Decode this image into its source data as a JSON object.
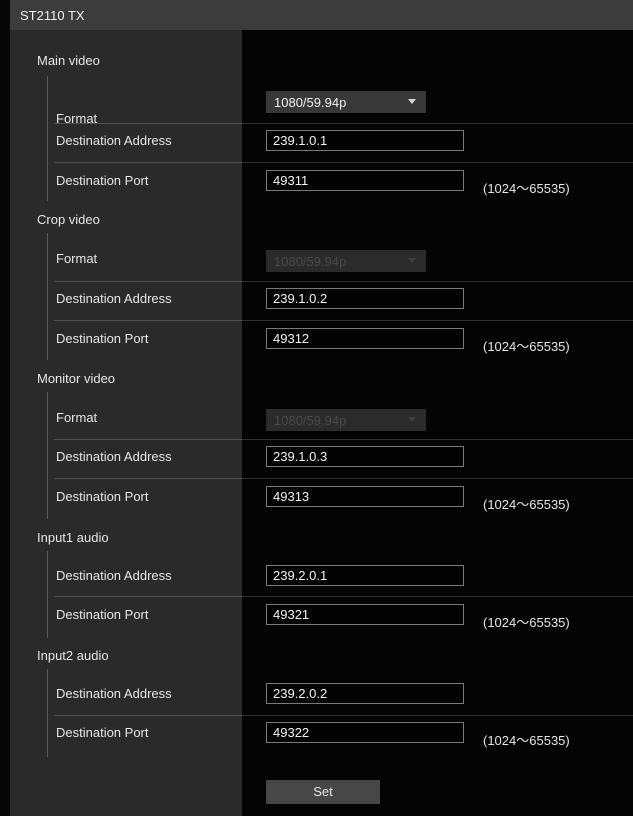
{
  "header": {
    "title": "ST2110 TX"
  },
  "main_video": {
    "title": "Main video",
    "format_label": "Format",
    "format_value": "1080/59.94p",
    "address_label": "Destination Address",
    "address_value": "239.1.0.1",
    "port_label": "Destination Port",
    "port_value": "49311",
    "port_range": "(1024～65535)"
  },
  "crop_video": {
    "title": "Crop video",
    "format_label": "Format",
    "format_value": "1080/59.94p",
    "address_label": "Destination Address",
    "address_value": "239.1.0.2",
    "port_label": "Destination Port",
    "port_value": "49312",
    "port_range": "(1024～65535)"
  },
  "monitor_video": {
    "title": "Monitor video",
    "format_label": "Format",
    "format_value": "1080/59.94p",
    "address_label": "Destination Address",
    "address_value": "239.1.0.3",
    "port_label": "Destination Port",
    "port_value": "49313",
    "port_range": "(1024～65535)"
  },
  "input1_audio": {
    "title": "Input1 audio",
    "address_label": "Destination Address",
    "address_value": "239.2.0.1",
    "port_label": "Destination Port",
    "port_value": "49321",
    "port_range": "(1024～65535)"
  },
  "input2_audio": {
    "title": "Input2 audio",
    "address_label": "Destination Address",
    "address_value": "239.2.0.2",
    "port_label": "Destination Port",
    "port_value": "49322",
    "port_range": "(1024～65535)"
  },
  "set_button": {
    "label": "Set"
  }
}
